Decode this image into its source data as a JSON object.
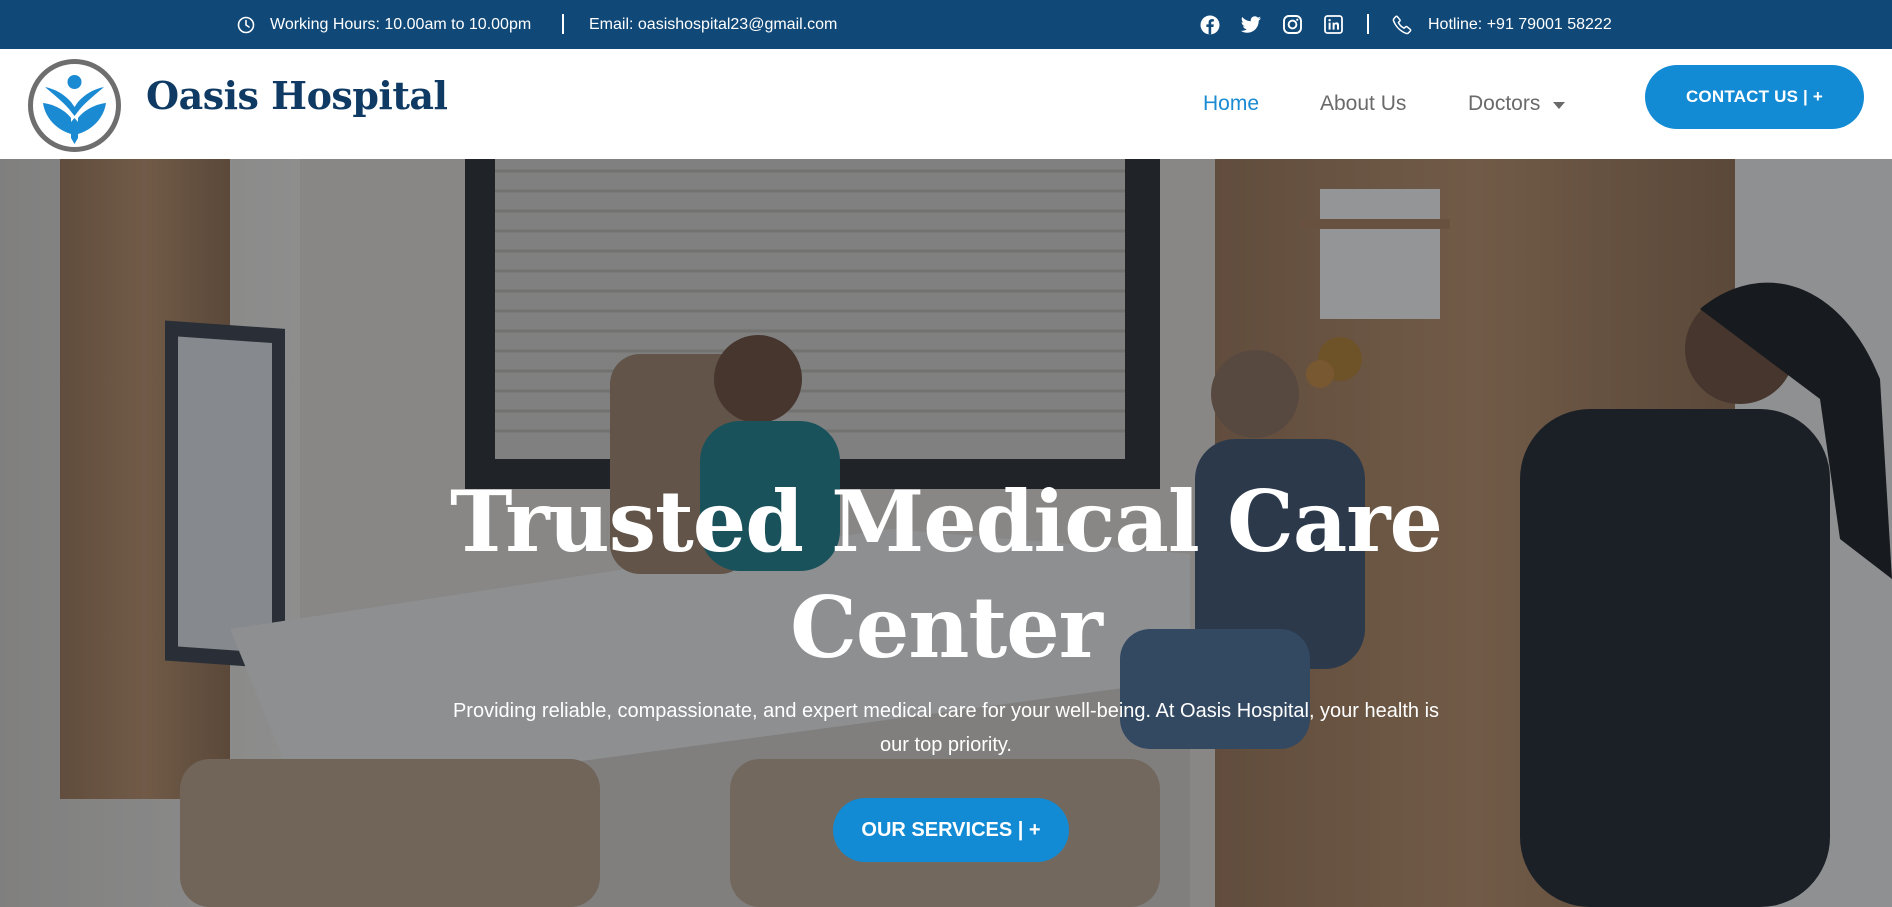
{
  "topbar": {
    "hours": "Working Hours: 10.00am to 10.00pm",
    "email": "Email: oasishospital23@gmail.com",
    "hotline": "Hotline: +91 79001 58222",
    "social": [
      "facebook-icon",
      "twitter-icon",
      "instagram-icon",
      "linkedin-icon"
    ],
    "background_color": "#104877"
  },
  "header": {
    "brand": "Oasis Hospital",
    "nav": {
      "home": "Home",
      "about": "About Us",
      "doctors": "Doctors"
    },
    "active_nav": "Home",
    "contact_button": "CONTACT US | +",
    "accent_color": "#138bd4",
    "brand_color": "#0f3a63"
  },
  "hero": {
    "title": "Trusted Medical Care Center",
    "subtitle": "Providing reliable, compassionate, and expert medical care for your well-being. At Oasis Hospital, your health is our top priority.",
    "button": "OUR SERVICES | +"
  }
}
